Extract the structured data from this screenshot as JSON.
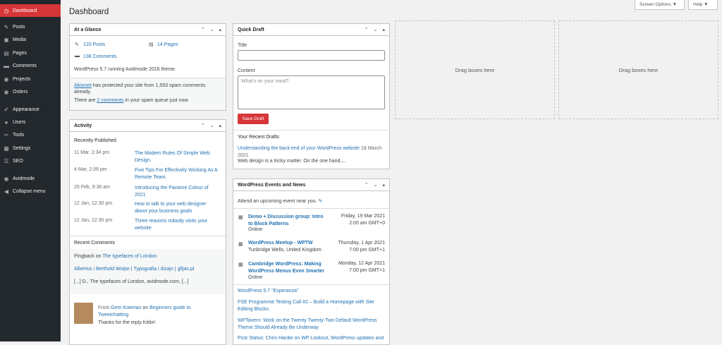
{
  "sidebar": {
    "items": [
      {
        "label": "Dashboard",
        "icon": "dashboard-icon",
        "glyph": "◷"
      },
      {
        "label": "Posts",
        "icon": "pin-icon",
        "glyph": "✎"
      },
      {
        "label": "Media",
        "icon": "media-icon",
        "glyph": "▣"
      },
      {
        "label": "Pages",
        "icon": "pages-icon",
        "glyph": "▤"
      },
      {
        "label": "Comments",
        "icon": "comment-icon",
        "glyph": "▬"
      },
      {
        "label": "Projects",
        "icon": "projects-icon",
        "glyph": "◉"
      },
      {
        "label": "Orders",
        "icon": "orders-icon",
        "glyph": "◉"
      },
      {
        "label": "Appearance",
        "icon": "brush-icon",
        "glyph": "✐"
      },
      {
        "label": "Users",
        "icon": "users-icon",
        "glyph": "●"
      },
      {
        "label": "Tools",
        "icon": "wrench-icon",
        "glyph": "✂"
      },
      {
        "label": "Settings",
        "icon": "settings-icon",
        "glyph": "▦"
      },
      {
        "label": "SEO",
        "icon": "seo-icon",
        "glyph": "☰"
      },
      {
        "label": "Avidmode",
        "icon": "avidmode-icon",
        "glyph": "◉"
      },
      {
        "label": "Collapse menu",
        "icon": "collapse-icon",
        "glyph": "◀"
      }
    ]
  },
  "header": {
    "title": "Dashboard",
    "screen_options": "Screen Options ▼",
    "help": "Help ▼"
  },
  "glance": {
    "title": "At a Glance",
    "posts": "120 Posts",
    "pages": "14 Pages",
    "comments": "138 Comments",
    "version": "WordPress 5.7 running Avidmode 2016 theme.",
    "akismet_link": "Akismet",
    "akismet_text": " has protected your site from 1,593 spam comments already.",
    "spam_pre": "There are ",
    "spam_link": "2 comments",
    "spam_post": " in your spam queue just now."
  },
  "activity": {
    "title": "Activity",
    "recently_published": "Recently Published",
    "posts": [
      {
        "date": "11 Mar, 2:34 pm",
        "title": "The Modern Rules Of Simple Web Design."
      },
      {
        "date": "4 Mar, 2:06 pm",
        "title": "Five Tips For Effectively Working As A Remote Team."
      },
      {
        "date": "25 Feb, 9:36 am",
        "title": "Introducing the Pantone Colour of 2021"
      },
      {
        "date": "12 Jan, 12:30 pm",
        "title": "How to talk to your web designer about your business goals"
      },
      {
        "date": "12 Jan, 12:30 pm",
        "title": "Three reasons nobody visits your website"
      }
    ],
    "recent_comments": "Recent Comments",
    "pingback_label": "Pingback on ",
    "pingback_link": "The typefaces of London",
    "pingback_author": "Albertus i Berthold Wolpe | Typografia i dizajn | gfijas.pl",
    "pingback_excerpt": "[...] D., The typefaces of London, avidmode.com, [...]",
    "comment_from": "From ",
    "comment_author": "Gem Koeman",
    "comment_on": " on ",
    "comment_post": "Beginners guide to Tweetchatting",
    "comment_text": "Thanks for the reply Kittie!"
  },
  "quick_draft": {
    "title": "Quick Draft",
    "title_label": "Title",
    "title_value": "",
    "content_label": "Content",
    "content_placeholder": "What's on your mind?",
    "save": "Save Draft",
    "recent_drafts": "Your Recent Drafts",
    "draft_title": "Understanding the back end of your WordPress website",
    "draft_date": "18 March 2021",
    "draft_excerpt": "Web design is a tricky matter. On the one hand,..."
  },
  "events": {
    "title": "WordPress Events and News",
    "attend": "Attend an upcoming event near you.",
    "items": [
      {
        "title": "Demo + Discussion group: Intro to Block Patterns",
        "location": "Online",
        "date": "Friday, 19 Mar 2021",
        "time": "2:00 am GMT+0"
      },
      {
        "title": "WordPress Meetup - WPTW",
        "location": "Tunbridge Wells, United Kingdom",
        "date": "Thursday, 1 Apr 2021",
        "time": "7:00 pm GMT+1"
      },
      {
        "title": "Cambridge WordPress: Making WordPress Menus Even Smarter",
        "location": "Online",
        "date": "Monday, 12 Apr 2021",
        "time": "7:00 pm GMT+1"
      }
    ],
    "news": [
      "WordPress 5.7 “Esperanza”",
      "FSE Programme Testing Call #2 – Build a Homepage with Site Editing Blocks",
      "WPTavern: Work on the Twenty Twenty-Two Default WordPress Theme Should Already Be Underway",
      "Post Status: Chris Hardie on WP Lookout, WordPress updates and"
    ]
  },
  "drop": {
    "label": "Drag boxes here"
  },
  "colors": {
    "sidebar": "#23282d",
    "accent": "#d63638",
    "link": "#2271b1"
  }
}
